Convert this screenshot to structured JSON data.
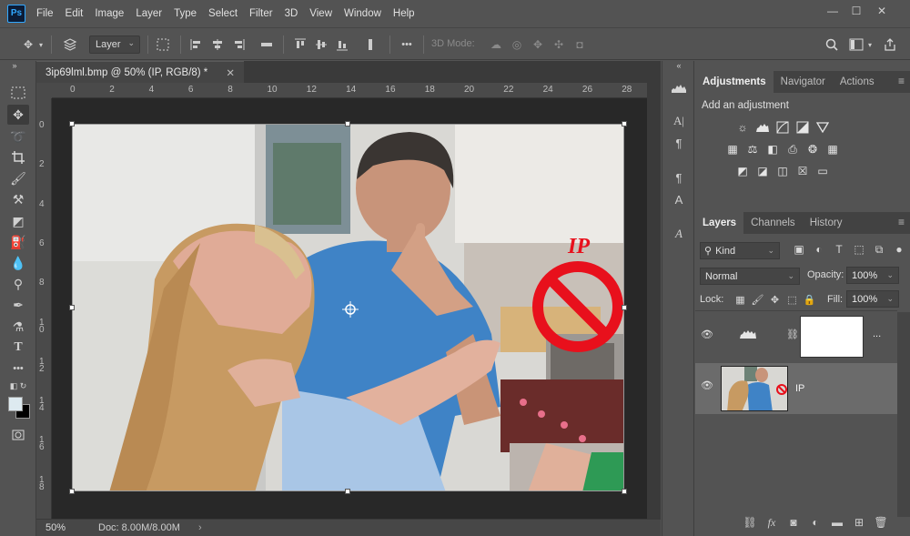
{
  "app": {
    "logo": "Ps"
  },
  "menu": [
    "File",
    "Edit",
    "Image",
    "Layer",
    "Type",
    "Select",
    "Filter",
    "3D",
    "View",
    "Window",
    "Help"
  ],
  "window_controls": {
    "minimize": "—",
    "restore": "☐",
    "close": "✕"
  },
  "options_bar": {
    "layer_select": "Layer",
    "mode_3d": "3D Mode:",
    "more": "•••"
  },
  "document": {
    "tab_title": "3ip69lml.bmp @ 50% (IP, RGB/8) *",
    "close": "✕",
    "ruler_h": [
      "0",
      "2",
      "4",
      "6",
      "8",
      "10",
      "12",
      "14",
      "16",
      "18",
      "20",
      "22",
      "24",
      "26",
      "28"
    ],
    "ruler_v": [
      "0",
      "2",
      "4",
      "6",
      "8",
      "1 0",
      "1 2",
      "1 4",
      "1 6",
      "1 8"
    ],
    "zoom": "50%",
    "doc_info": "Doc: 8.00M/8.00M",
    "status_chev": "›"
  },
  "image_overlay": {
    "watermark_text": "IP"
  },
  "adjustments_panel": {
    "tabs": [
      "Adjustments",
      "Navigator",
      "Actions"
    ],
    "title": "Add an adjustment"
  },
  "layers_panel": {
    "tabs": [
      "Layers",
      "Channels",
      "History"
    ],
    "filter_kind": "Kind",
    "blend_mode": "Normal",
    "opacity_label": "Opacity:",
    "opacity_value": "100%",
    "lock_label": "Lock:",
    "fill_label": "Fill:",
    "fill_value": "100%",
    "layers": [
      {
        "name": "",
        "type": "levels-adjustment",
        "more": "...",
        "selected": false
      },
      {
        "name": "IP",
        "type": "image",
        "selected": true
      }
    ],
    "bottom_icons": [
      "link-icon",
      "fx-icon",
      "mask-icon",
      "adjustment-icon",
      "group-icon",
      "new-layer-icon",
      "trash-icon"
    ]
  },
  "colors": {
    "ui_bg": "#535353",
    "canvas_bg": "#282828",
    "accent": "#31a8ff",
    "forbidden_red": "#e8101c"
  }
}
